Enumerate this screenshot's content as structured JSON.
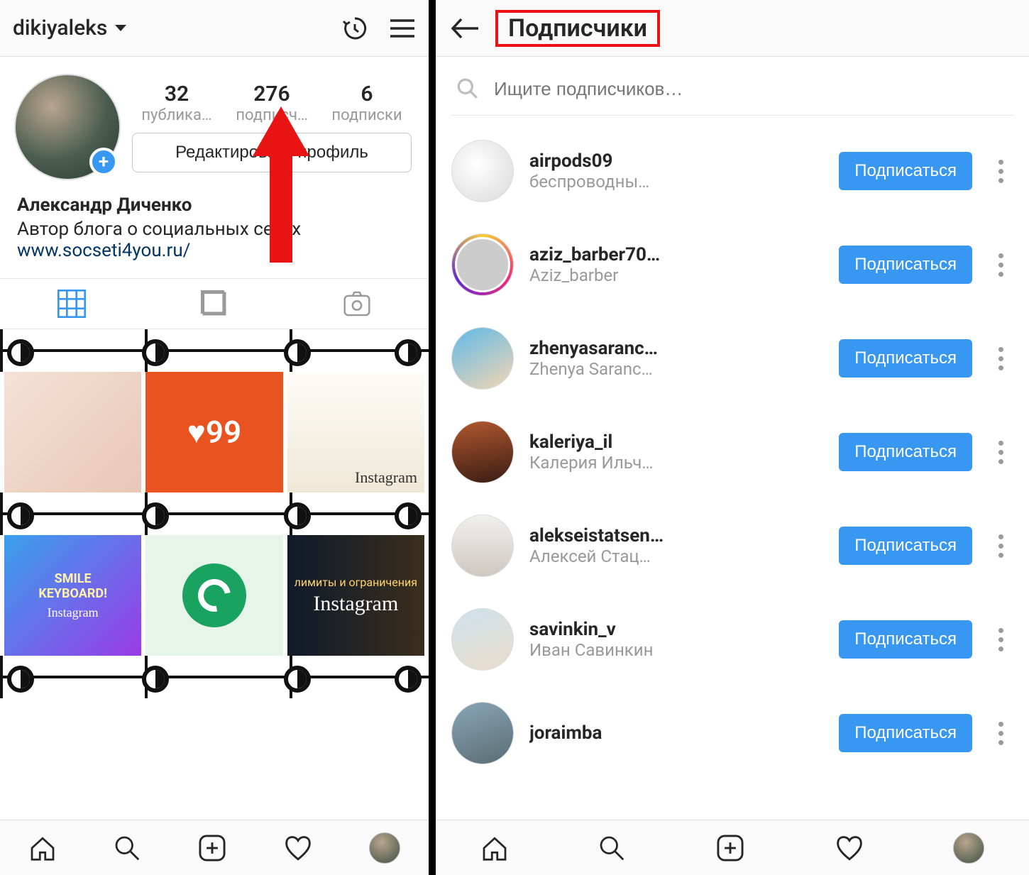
{
  "left": {
    "username": "dikiyaleks",
    "stats": {
      "posts": {
        "count": "32",
        "label": "публика…"
      },
      "followers": {
        "count": "276",
        "label": "подписч…"
      },
      "following": {
        "count": "6",
        "label": "подписки"
      }
    },
    "editProfile": "Редактировать профиль",
    "bio": {
      "name": "Александр Диченко",
      "text": "Автор блога о социальных сетях",
      "link": "www.socseti4you.ru/"
    },
    "thumbs": {
      "t2": "♥99",
      "t3": "Instagram",
      "t4a": "SMILE",
      "t4b": "KEYBOARD!",
      "t4c": "Instagram",
      "t6a": "лимиты и ограничения",
      "t6b": "Instagram"
    }
  },
  "right": {
    "title": "Подписчики",
    "searchPlaceholder": "Ищите подписчиков…",
    "followLabel": "Подписаться",
    "followers": [
      {
        "user": "airpods09",
        "name": "беспроводны…",
        "avatarClass": "a0",
        "story": false
      },
      {
        "user": "aziz_barber70…",
        "name": "Aziz_barber",
        "avatarClass": "",
        "story": true
      },
      {
        "user": "zhenyasaranc…",
        "name": "Zhenya Saranc…",
        "avatarClass": "a2",
        "story": false
      },
      {
        "user": "kaleriya_il",
        "name": "Калерия Ильч…",
        "avatarClass": "a3",
        "story": false
      },
      {
        "user": "alekseistatsen…",
        "name": "Алексей Стац…",
        "avatarClass": "a4",
        "story": false
      },
      {
        "user": "savinkin_v",
        "name": "Иван Савинкин",
        "avatarClass": "a5",
        "story": false
      },
      {
        "user": "joraimba",
        "name": "",
        "avatarClass": "a6",
        "story": false
      }
    ]
  }
}
